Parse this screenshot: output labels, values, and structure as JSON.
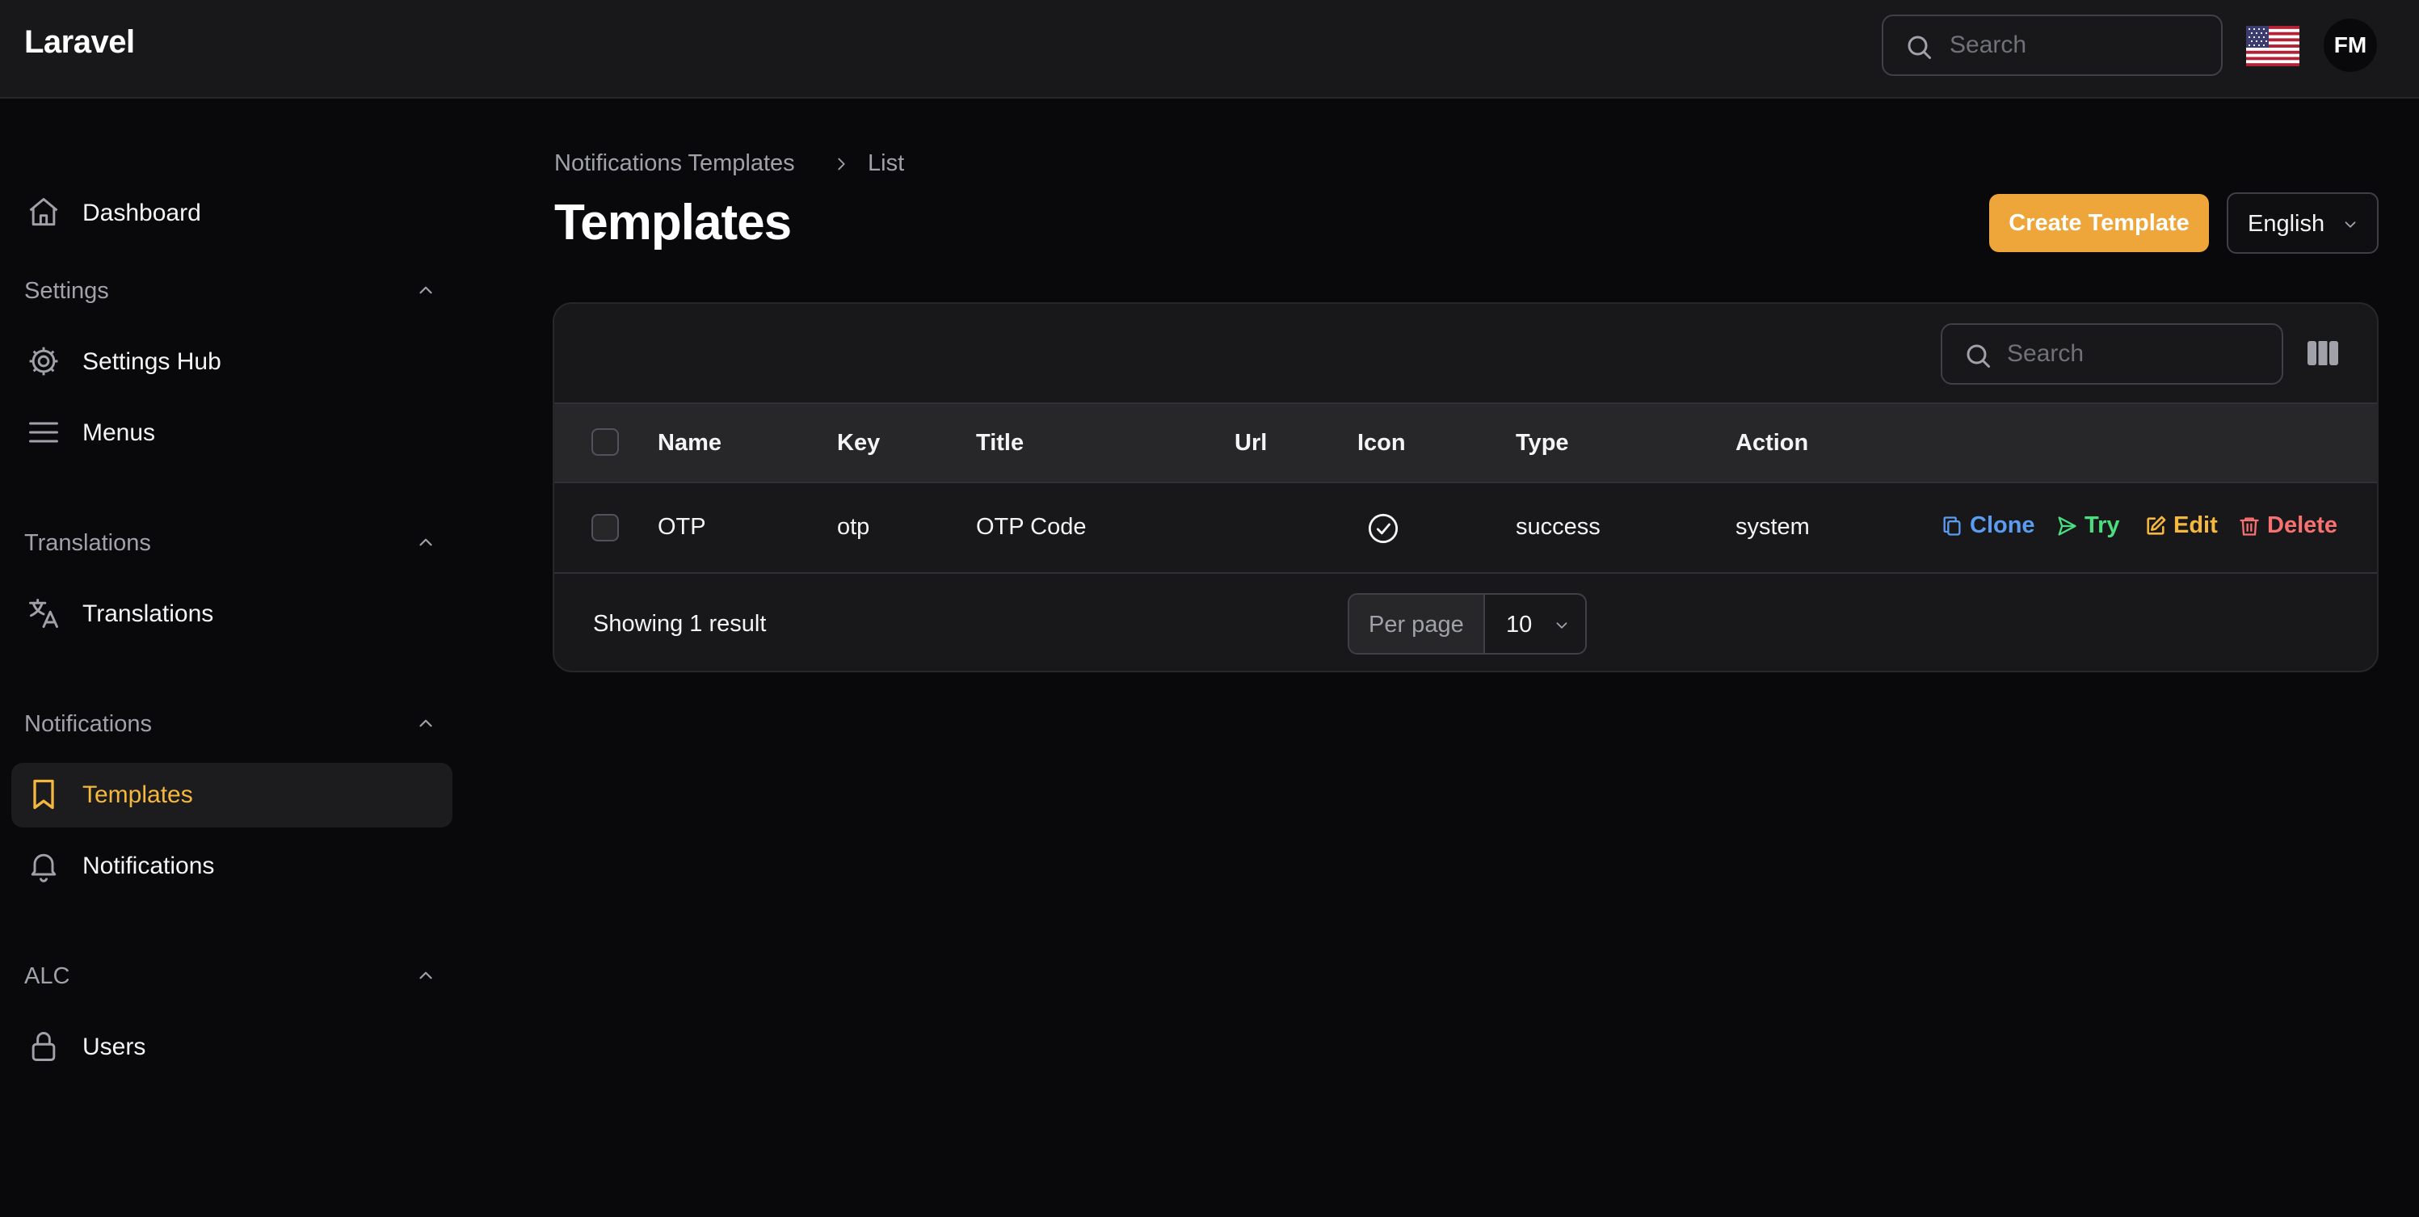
{
  "app": {
    "brand": "Laravel"
  },
  "topbar": {
    "search_placeholder": "Search",
    "language_flag": "us-flag-icon",
    "user_initials": "FM"
  },
  "sidebar": {
    "dashboard": {
      "label": "Dashboard",
      "icon": "home-icon"
    },
    "groups": [
      {
        "label": "Settings",
        "items": [
          {
            "label": "Settings Hub",
            "icon": "gear-icon"
          },
          {
            "label": "Menus",
            "icon": "menu-icon"
          }
        ]
      },
      {
        "label": "Translations",
        "items": [
          {
            "label": "Translations",
            "icon": "translate-icon"
          }
        ]
      },
      {
        "label": "Notifications",
        "items": [
          {
            "label": "Templates",
            "icon": "bookmark-icon",
            "active": true
          },
          {
            "label": "Notifications",
            "icon": "bell-icon"
          }
        ]
      },
      {
        "label": "ALC",
        "items": [
          {
            "label": "Users",
            "icon": "lock-icon"
          }
        ]
      }
    ]
  },
  "breadcrumb": {
    "parent": "Notifications Templates",
    "current": "List"
  },
  "page": {
    "title": "Templates",
    "create_button": "Create Template",
    "language": "English"
  },
  "table": {
    "search_placeholder": "Search",
    "columns": [
      "Name",
      "Key",
      "Title",
      "Url",
      "Icon",
      "Type",
      "Action"
    ],
    "rows": [
      {
        "name": "OTP",
        "key": "otp",
        "title": "OTP Code",
        "url": "",
        "icon": "check-circle-icon",
        "type": "success",
        "action": "system"
      }
    ],
    "row_actions": [
      {
        "label": "Clone",
        "icon": "copy-icon",
        "color": "#5b9cf0"
      },
      {
        "label": "Try",
        "icon": "send-icon",
        "color": "#4ade80"
      },
      {
        "label": "Edit",
        "icon": "edit-icon",
        "color": "#f5b83d"
      },
      {
        "label": "Delete",
        "icon": "trash-icon",
        "color": "#f87171"
      }
    ],
    "footer": {
      "result_text": "Showing 1 result",
      "per_page_label": "Per page",
      "per_page_value": "10"
    }
  },
  "colors": {
    "accent": "#eea53a",
    "active_nav": "#f5b83d",
    "background": "#09090b",
    "surface": "#18181b"
  }
}
